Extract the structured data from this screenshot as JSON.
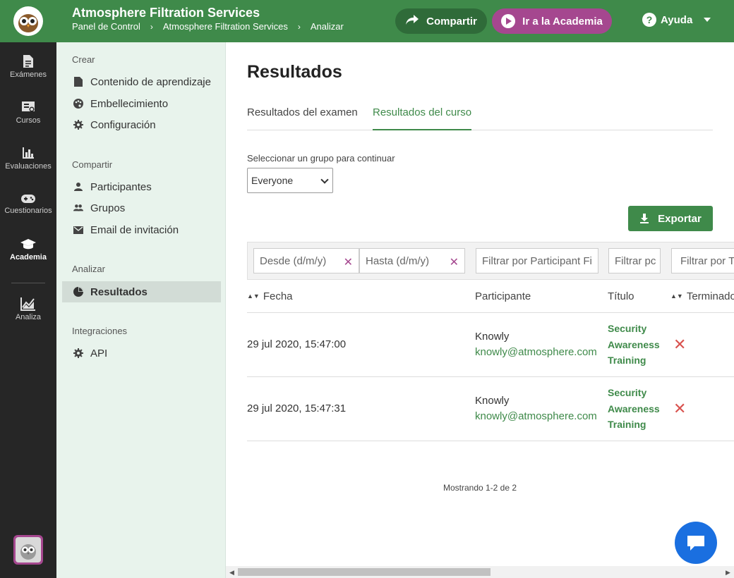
{
  "header": {
    "title": "Atmosphere Filtration Services",
    "breadcrumbs": [
      "Panel de Control",
      "Atmosphere Filtration Services",
      "Analizar"
    ],
    "share_label": "Compartir",
    "academy_label": "Ir a la Academia",
    "help_label": "Ayuda",
    "colors": {
      "brand": "#3f8a4a",
      "academy": "#a5478f"
    }
  },
  "rail": {
    "items": [
      {
        "label": "Exámenes",
        "icon": "document-icon"
      },
      {
        "label": "Cursos",
        "icon": "course-icon"
      },
      {
        "label": "Evaluaciones",
        "icon": "bar-chart-icon"
      },
      {
        "label": "Cuestionarios",
        "icon": "gamepad-icon"
      },
      {
        "label": "Academia",
        "icon": "graduation-cap-icon"
      },
      {
        "label": "Analiza",
        "icon": "line-chart-icon"
      }
    ],
    "active": "Academia"
  },
  "subnav": {
    "create_title": "Crear",
    "create_items": [
      "Contenido de aprendizaje",
      "Embellecimiento",
      "Configuración"
    ],
    "share_title": "Compartir",
    "share_items": [
      "Participantes",
      "Grupos",
      "Email de invitación"
    ],
    "analyze_title": "Analizar",
    "analyze_items": [
      "Resultados"
    ],
    "integrations_title": "Integraciones",
    "integrations_items": [
      "API"
    ]
  },
  "main": {
    "title": "Resultados",
    "tabs": [
      "Resultados del examen",
      "Resultados del curso"
    ],
    "active_tab": "Resultados del curso",
    "group_label": "Seleccionar un grupo para continuar",
    "group_value": "Everyone",
    "export_label": "Exportar",
    "filters": {
      "from": "Desde (d/m/y)",
      "to": "Hasta (d/m/y)",
      "participant": "Filtrar por Participant Fi",
      "title": "Filtrar pc",
      "finished": "Filtrar por T"
    },
    "columns": [
      "Fecha",
      "Participante",
      "Título",
      "Terminado"
    ],
    "rows": [
      {
        "date": "29 jul 2020, 15:47:00",
        "name": "Knowly",
        "email": "knowly@atmosphere.com",
        "course": [
          "Security",
          "Awareness",
          "Training"
        ],
        "finished": "✕"
      },
      {
        "date": "29 jul 2020, 15:47:31",
        "name": "Knowly",
        "email": "knowly@atmosphere.com",
        "course": [
          "Security",
          "Awareness",
          "Training"
        ],
        "finished": "✕"
      }
    ],
    "showing": "Mostrando 1-2 de 2"
  }
}
